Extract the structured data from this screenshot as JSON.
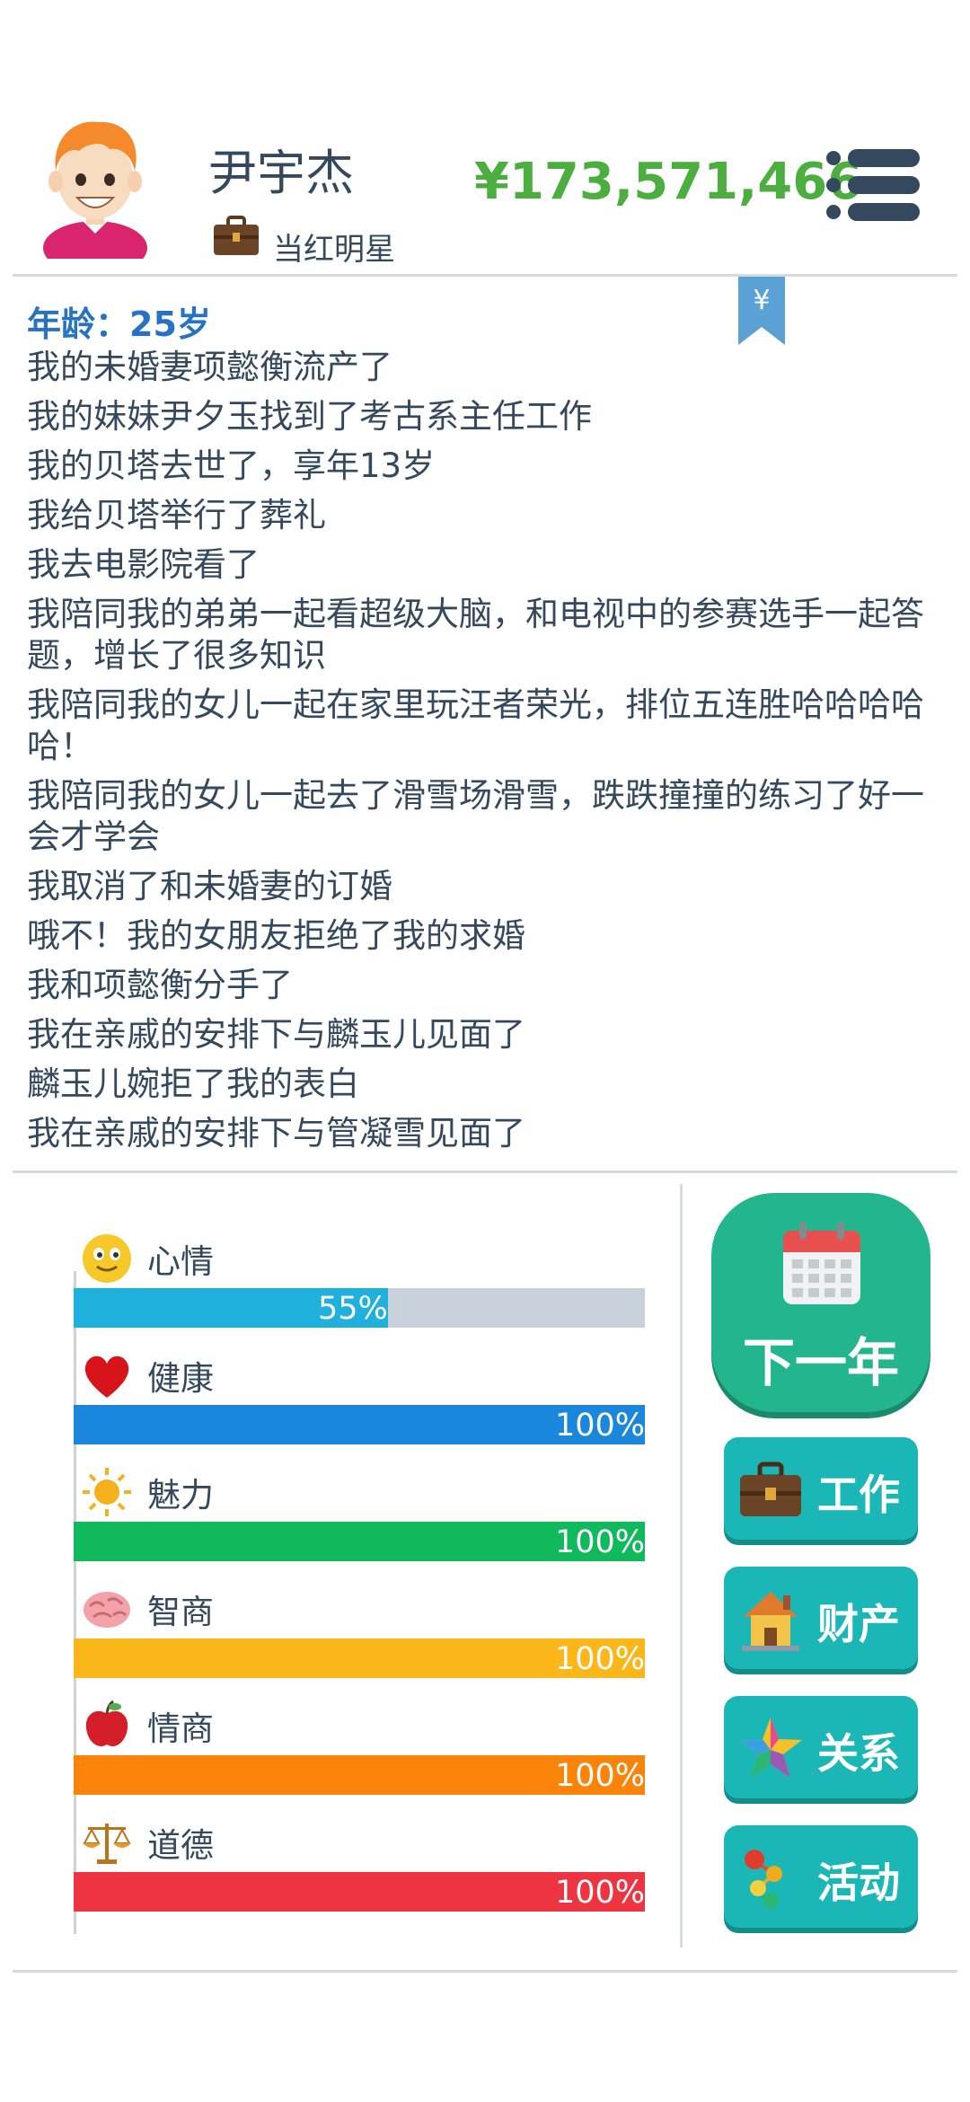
{
  "header": {
    "name": "尹宇杰",
    "job_title": "当红明星",
    "money": "¥173,571,466"
  },
  "log": {
    "age_line": "年龄：25岁",
    "entries": [
      "我的未婚妻项懿衡流产了",
      "我的妹妹尹夕玉找到了考古系主任工作",
      "我的贝塔去世了，享年13岁",
      "我给贝塔举行了葬礼",
      "我去电影院看了",
      "我陪同我的弟弟一起看超级大脑，和电视中的参赛选手一起答题，增长了很多知识",
      "我陪同我的女儿一起在家里玩汪者荣光，排位五连胜哈哈哈哈哈！",
      "我陪同我的女儿一起去了滑雪场滑雪，跌跌撞撞的练习了好一会才学会",
      "我取消了和未婚妻的订婚",
      "哦不！我的女朋友拒绝了我的求婚",
      "我和项懿衡分手了",
      "我在亲戚的安排下与麟玉儿见面了",
      "麟玉儿婉拒了我的表白",
      "我在亲戚的安排下与管凝雪见面了"
    ]
  },
  "stats": [
    {
      "label": "心情",
      "value": 55,
      "value_text": "55%",
      "color": "#1fb1dc",
      "icon": "smiley-icon"
    },
    {
      "label": "健康",
      "value": 100,
      "value_text": "100%",
      "color": "#1a87dc",
      "icon": "heart-icon"
    },
    {
      "label": "魅力",
      "value": 100,
      "value_text": "100%",
      "color": "#0fb95c",
      "icon": "sun-icon"
    },
    {
      "label": "智商",
      "value": 100,
      "value_text": "100%",
      "color": "#fbb61a",
      "icon": "brain-icon"
    },
    {
      "label": "情商",
      "value": 100,
      "value_text": "100%",
      "color": "#f98409",
      "icon": "apple-icon"
    },
    {
      "label": "道德",
      "value": 100,
      "value_text": "100%",
      "color": "#ee3441",
      "icon": "scales-icon"
    }
  ],
  "buttons": {
    "next_year": "下一年",
    "work": "工作",
    "assets": "财产",
    "relations": "关系",
    "activities": "活动"
  },
  "colors": {
    "money": "#4cae3f",
    "age": "#2672c3",
    "next_year_bg": "#23b58e",
    "side_button_bg": "#1bb7b6"
  }
}
